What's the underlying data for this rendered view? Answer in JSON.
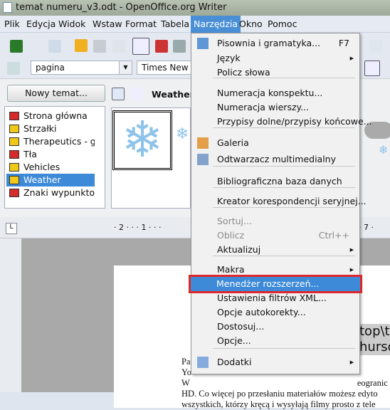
{
  "window": {
    "title": "temat numeru_v3.odt - OpenOffice.org Writer"
  },
  "menubar": [
    "Plik",
    "Edycja",
    "Widok",
    "Wstaw",
    "Format",
    "Tabela",
    "Narzędzia",
    "Okno",
    "Pomoc"
  ],
  "toolbar": {
    "style": "pagina",
    "font": "Times New R"
  },
  "gallery": {
    "new_theme": "Nowy temat...",
    "header": "Weather -",
    "themes": [
      {
        "label": "Strona główna",
        "color": "#d42a2a"
      },
      {
        "label": "Strzałki",
        "color": "#f0c818"
      },
      {
        "label": "Therapeutics - gen",
        "color": "#f0c818"
      },
      {
        "label": "Tła",
        "color": "#d42a2a"
      },
      {
        "label": "Vehicles",
        "color": "#f0c818"
      },
      {
        "label": "Weather",
        "color": "#f0c818",
        "selected": true
      },
      {
        "label": "Znaki wypunktowa",
        "color": "#d42a2a"
      }
    ]
  },
  "ruler": {
    "left": "· 2 · · · 1 · · ·",
    "right": "· 7 ·"
  },
  "document": {
    "field1": "top\\te",
    "field2": "hursda",
    "lines": [
      "Pa",
      "Yo",
      "W",
      "HD. Co więcej po przesłaniu materiałów możesz edyto",
      "wszystkich, którzy kręcą i wysyłają filmy prosto z tele"
    ],
    "right_frag": "eogranic"
  },
  "menu": {
    "items": [
      {
        "label": "Pisownia i gramatyka...",
        "shortcut": "F7",
        "icon": "spellcheck-icon"
      },
      {
        "label": "Język",
        "submenu": true
      },
      {
        "label": "Policz słowa"
      },
      {
        "label": "Numeracja konspektu..."
      },
      {
        "label": "Numeracja wierszy..."
      },
      {
        "label": "Przypisy dolne/przypisy końcowe..."
      },
      {
        "label": "Galeria",
        "icon": "gallery-icon"
      },
      {
        "label": "Odtwarzacz multimedialny",
        "icon": "media-player-icon"
      },
      {
        "label": "Bibliograficzna baza danych"
      },
      {
        "label": "Kreator korespondencji seryjnej..."
      },
      {
        "label": "Sortuj...",
        "disabled": true
      },
      {
        "label": "Oblicz",
        "shortcut": "Ctrl++",
        "disabled": true
      },
      {
        "label": "Aktualizuj",
        "submenu": true
      },
      {
        "label": "Makra",
        "submenu": true
      },
      {
        "label": "Menedżer rozszerzeń...",
        "highlighted": true
      },
      {
        "label": "Ustawienia filtrów XML..."
      },
      {
        "label": "Opcje autokorekty..."
      },
      {
        "label": "Dostosuj..."
      },
      {
        "label": "Opcje..."
      },
      {
        "label": "Dodatki",
        "submenu": true,
        "icon": "addons-icon"
      }
    ]
  },
  "colors": {
    "highlight": "#3d8ad8",
    "outline": "#e02828"
  }
}
